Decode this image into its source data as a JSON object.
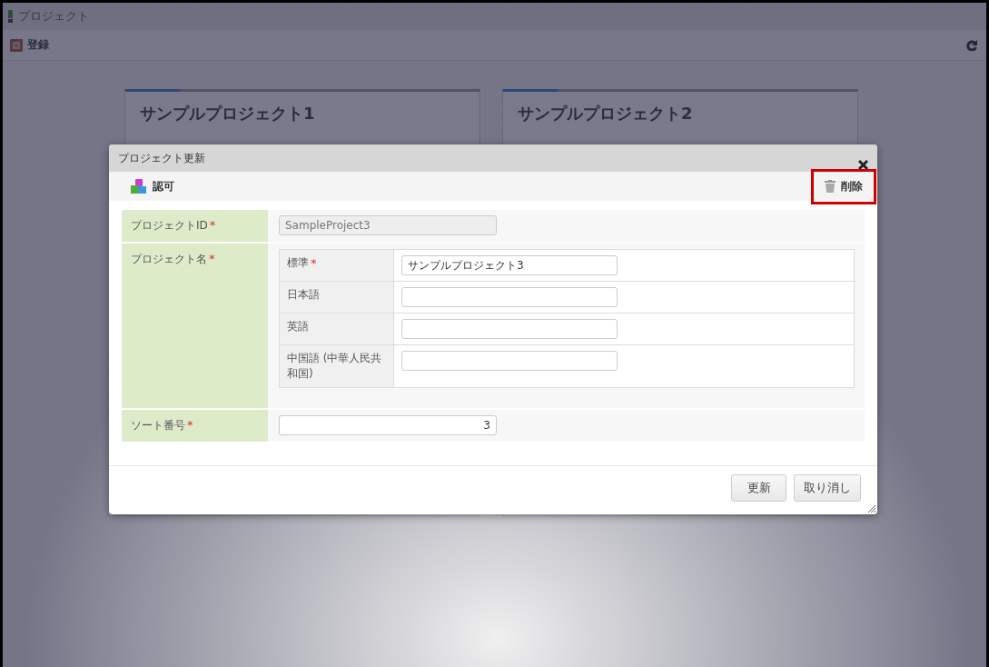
{
  "page": {
    "title": "プロジェクト",
    "toolbar": {
      "register": "登録"
    },
    "cards": [
      {
        "title": "サンプルプロジェクト1"
      },
      {
        "title": "サンプルプロジェクト2"
      }
    ]
  },
  "dialog": {
    "title": "プロジェクト更新",
    "toolbar": {
      "permission": "認可",
      "delete": "削除",
      "delete_highlighted": true
    },
    "fields": [
      {
        "kind": "text",
        "label": "プロジェクトID",
        "required_mark": "*",
        "value": "SampleProject3",
        "disabled": true
      },
      {
        "kind": "multilang",
        "label": "プロジェクト名",
        "required_mark": "*",
        "languages": [
          {
            "label": "標準",
            "required_mark": "*",
            "value": "サンプルプロジェクト3"
          },
          {
            "label": "日本語"
          },
          {
            "label": "英語"
          },
          {
            "label": "中国語 (中華人民共和国)"
          }
        ]
      },
      {
        "kind": "number",
        "label": "ソート番号",
        "required_mark": "*",
        "value": "3",
        "disabled": false
      }
    ],
    "buttons": [
      "更新",
      "取り消し"
    ]
  }
}
